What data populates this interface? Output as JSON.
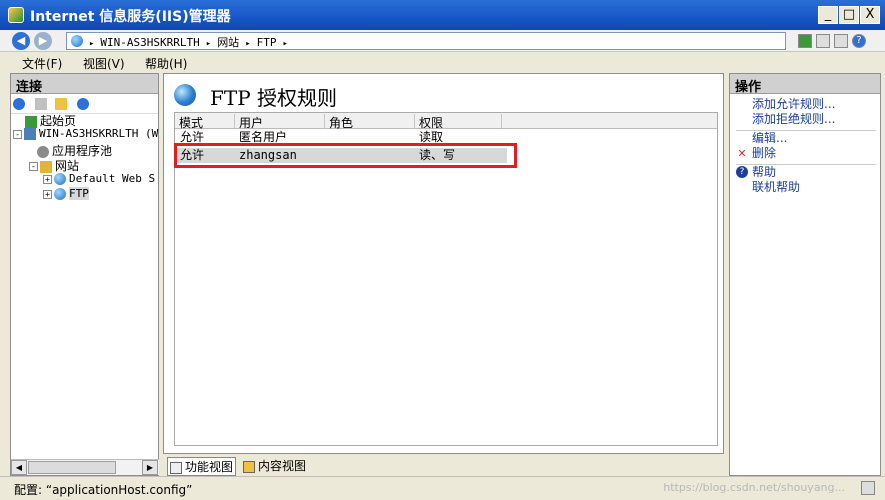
{
  "window": {
    "title": "Internet 信息服务(IIS)管理器",
    "controls": [
      "_",
      "□",
      "X"
    ]
  },
  "address": {
    "crumbs": [
      "WIN-AS3HSKRRLTH",
      "网站",
      "FTP"
    ],
    "separator": "▸"
  },
  "menu": [
    "文件(F)",
    "视图(V)",
    "帮助(H)"
  ],
  "connections": {
    "header": "连接",
    "tree": [
      {
        "label": "起始页",
        "indent": 0,
        "toggle": ""
      },
      {
        "label": "WIN-AS3HSKRRLTH (W",
        "indent": 0,
        "toggle": "-"
      },
      {
        "label": "应用程序池",
        "indent": 1,
        "toggle": ""
      },
      {
        "label": "网站",
        "indent": 1,
        "toggle": "-"
      },
      {
        "label": "Default Web S",
        "indent": 2,
        "toggle": "+"
      },
      {
        "label": "FTP",
        "indent": 2,
        "toggle": "+"
      }
    ]
  },
  "feature": {
    "title": "FTP 授权规则",
    "columns": [
      "模式",
      "用户",
      "角色",
      "权限"
    ],
    "rows": [
      {
        "mode": "允许",
        "user": "匿名用户",
        "role": "",
        "perm": "读取"
      },
      {
        "mode": "允许",
        "user": "zhangsan",
        "role": "",
        "perm": "读、写"
      }
    ]
  },
  "view_tabs": [
    "功能视图",
    "内容视图"
  ],
  "actions": {
    "header": "操作",
    "items": [
      {
        "label": "添加允许规则...",
        "icon": ""
      },
      {
        "label": "添加拒绝规则...",
        "icon": ""
      },
      {
        "label": "编辑...",
        "icon": ""
      },
      {
        "label": "删除",
        "icon": "✕",
        "icon_color": "#d32f2f"
      },
      {
        "label": "帮助",
        "icon": "?",
        "icon_color": "#1c3f9f"
      },
      {
        "label": "联机帮助",
        "icon": ""
      }
    ]
  },
  "status": {
    "text": "配置: “applicationHost.config”",
    "watermark": "https://blog.csdn.net/shouyang..."
  },
  "colors": {
    "titlebar": "#1656c6",
    "link": "#1c3f9f",
    "highlight_box": "#e02020"
  }
}
